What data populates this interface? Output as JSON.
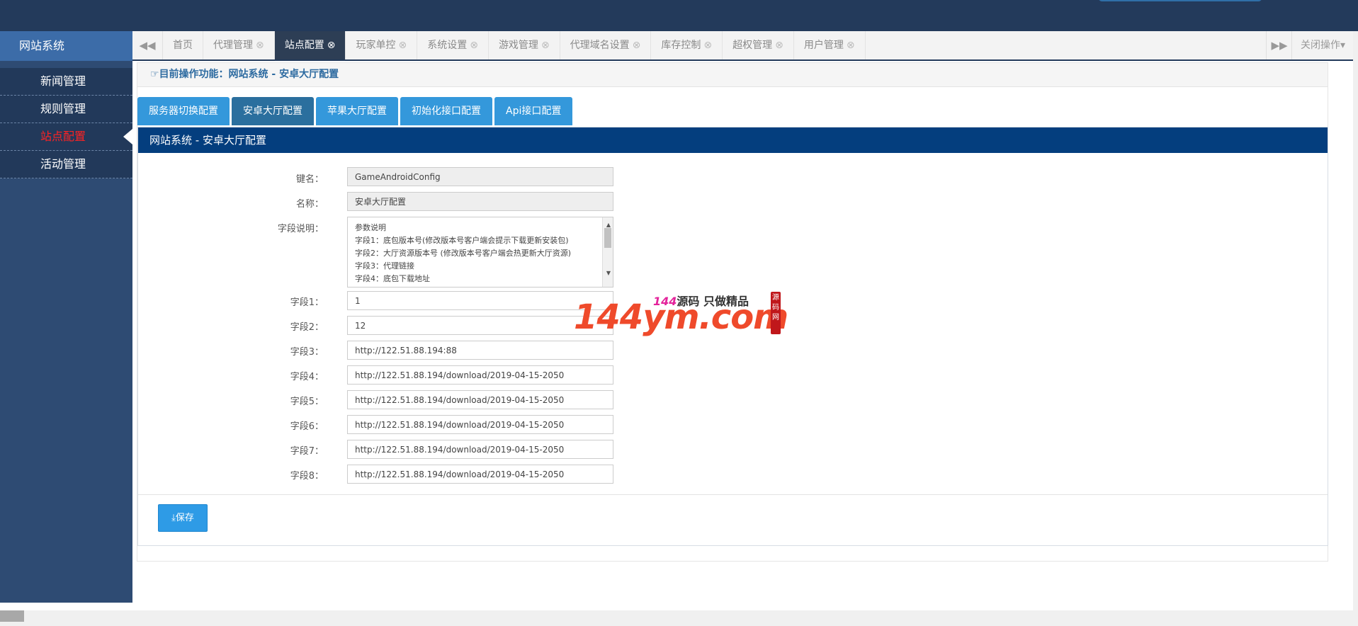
{
  "sidebar": {
    "title": "网站系统",
    "items": [
      {
        "label": "新闻管理",
        "active": false
      },
      {
        "label": "规则管理",
        "active": false
      },
      {
        "label": "站点配置",
        "active": true
      },
      {
        "label": "活动管理",
        "active": false
      }
    ]
  },
  "tabbar": {
    "tabs": [
      {
        "label": "首页",
        "closable": false
      },
      {
        "label": "代理管理",
        "closable": true
      },
      {
        "label": "站点配置",
        "closable": true,
        "active": true
      },
      {
        "label": "玩家单控",
        "closable": true
      },
      {
        "label": "系统设置",
        "closable": true
      },
      {
        "label": "游戏管理",
        "closable": true
      },
      {
        "label": "代理域名设置",
        "closable": true
      },
      {
        "label": "库存控制",
        "closable": true
      },
      {
        "label": "超权管理",
        "closable": true
      },
      {
        "label": "用户管理",
        "closable": true
      }
    ],
    "close_ops": "关闭操作"
  },
  "breadcrumb": "目前操作功能：网站系统 - 安卓大厅配置",
  "subtabs": [
    {
      "label": "服务器切换配置",
      "active": false
    },
    {
      "label": "安卓大厅配置",
      "active": true
    },
    {
      "label": "苹果大厅配置",
      "active": false
    },
    {
      "label": "初始化接口配置",
      "active": false
    },
    {
      "label": "Api接口配置",
      "active": false
    }
  ],
  "panel": {
    "title": "网站系统 - 安卓大厅配置",
    "key_label": "键名：",
    "key_value": "GameAndroidConfig",
    "name_label": "名称：",
    "name_value": "安卓大厅配置",
    "desc_label": "字段说明：",
    "desc_lines": [
      "参数说明",
      "字段1：底包版本号(修改版本号客户端会提示下载更新安装包)",
      "字段2：大厅资源版本号 (修改版本号客户端会热更新大厅资源)",
      "字段3：代理链接",
      "字段4：底包下载地址"
    ],
    "fields": [
      {
        "label": "字段1：",
        "value": "1"
      },
      {
        "label": "字段2：",
        "value": "12"
      },
      {
        "label": "字段3：",
        "value": "http://122.51.88.194:88"
      },
      {
        "label": "字段4：",
        "value": "http://122.51.88.194/download/2019-04-15-2050"
      },
      {
        "label": "字段5：",
        "value": "http://122.51.88.194/download/2019-04-15-2050"
      },
      {
        "label": "字段6：",
        "value": "http://122.51.88.194/download/2019-04-15-2050"
      },
      {
        "label": "字段7：",
        "value": "http://122.51.88.194/download/2019-04-15-2050"
      },
      {
        "label": "字段8：",
        "value": "http://122.51.88.194/download/2019-04-15-2050"
      }
    ],
    "save_label": "保存"
  },
  "watermark": {
    "number": "144ym.com",
    "tag_prefix": "144",
    "tag_text": "源码 只做精品",
    "seal": "源码网"
  },
  "colors": {
    "topbar": "#233a5b",
    "sidebar": "#2e4b73",
    "accent": "#3498db",
    "panel_head": "#043e7e",
    "active_menu_text": "#ff2222"
  }
}
